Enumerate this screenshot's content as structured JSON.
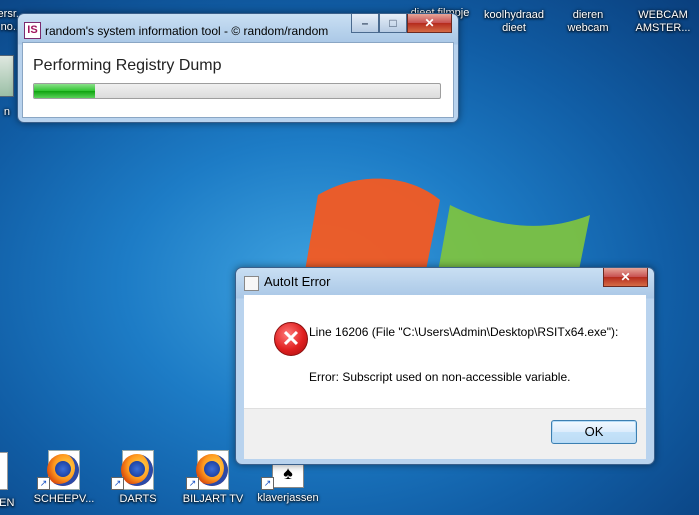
{
  "desktop": {
    "top_icons": [
      {
        "label": "dieet filmpje"
      },
      {
        "label": "koolhydraad\ndieet"
      },
      {
        "label": "dieren\nwebcam"
      },
      {
        "label": "WEBCAM\nAMSTER..."
      }
    ],
    "left_partial_top": "ersr..\nno...",
    "left_partial_mid": "n",
    "bottom_icons": [
      {
        "label": "IGEN"
      },
      {
        "label": "SCHEEPV..."
      },
      {
        "label": "DARTS"
      },
      {
        "label": "BILJART TV"
      },
      {
        "label": "klaverjassen"
      }
    ]
  },
  "progress_window": {
    "title": "random's system information tool - © random/random",
    "status_text": "Performing Registry Dump",
    "progress_fraction": 0.15
  },
  "error_dialog": {
    "title": "AutoIt Error",
    "line1": "Line 16206  (File \"C:\\Users\\Admin\\Desktop\\RSITx64.exe\"):",
    "line2": "Error: Subscript used on non-accessible variable.",
    "ok_label": "OK"
  },
  "colors": {
    "progress_green": "#1fb51f",
    "error_red": "#e02020",
    "desktop_blue": "#1d7cc6"
  }
}
